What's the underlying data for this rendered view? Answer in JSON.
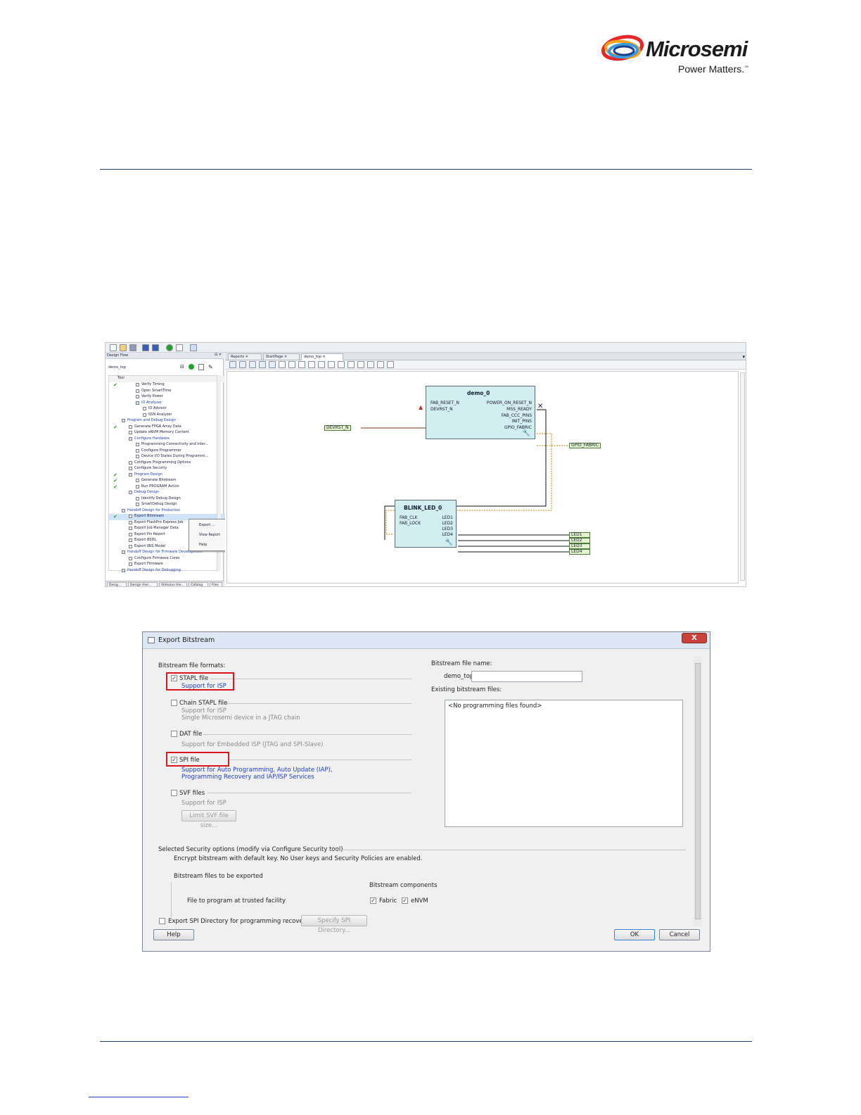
{
  "header": {
    "logo_text": "Microsemi",
    "tagline": "Power Matters.",
    "tm": "™"
  },
  "libero": {
    "design_flow": {
      "title": "Design Flow",
      "root": "demo_top",
      "column": "Tool",
      "items": [
        {
          "label": "Verify Timing",
          "indent": 46,
          "check": true,
          "blue": false
        },
        {
          "label": "Open SmartTime",
          "indent": 46,
          "check": false,
          "blue": false
        },
        {
          "label": "Verify Power",
          "indent": 46,
          "check": false,
          "blue": false
        },
        {
          "label": "IO Analyzer",
          "indent": 46,
          "check": false,
          "blue": true
        },
        {
          "label": "IO Advisor",
          "indent": 56,
          "check": false,
          "blue": false
        },
        {
          "label": "SSN Analyzer",
          "indent": 56,
          "check": false,
          "blue": false
        },
        {
          "label": "Program and Debug Design",
          "indent": 26,
          "check": false,
          "blue": true
        },
        {
          "label": "Generate FPGA Array Data",
          "indent": 36,
          "check": true,
          "blue": false
        },
        {
          "label": "Update eNVM Memory Content",
          "indent": 36,
          "check": false,
          "blue": false
        },
        {
          "label": "Configure Hardware",
          "indent": 36,
          "check": false,
          "blue": true
        },
        {
          "label": "Programming Connectivity and Inter...",
          "indent": 46,
          "check": false,
          "blue": false
        },
        {
          "label": "Configure Programmer",
          "indent": 46,
          "check": false,
          "blue": false
        },
        {
          "label": "Device I/O States During Programmi...",
          "indent": 46,
          "check": false,
          "blue": false
        },
        {
          "label": "Configure Programming Options",
          "indent": 36,
          "check": false,
          "blue": false
        },
        {
          "label": "Configure Security",
          "indent": 36,
          "check": false,
          "blue": false
        },
        {
          "label": "Program Design",
          "indent": 36,
          "check": true,
          "blue": true
        },
        {
          "label": "Generate Bitstream",
          "indent": 46,
          "check": true,
          "blue": false
        },
        {
          "label": "Run PROGRAM Action",
          "indent": 46,
          "check": true,
          "blue": false
        },
        {
          "label": "Debug Design",
          "indent": 36,
          "check": false,
          "blue": true
        },
        {
          "label": "Identify Debug Design",
          "indent": 46,
          "check": false,
          "blue": false
        },
        {
          "label": "SmartDebug Design",
          "indent": 46,
          "check": false,
          "blue": false
        },
        {
          "label": "Handoff Design for Production",
          "indent": 26,
          "check": false,
          "blue": true
        },
        {
          "label": "Export Bitstream",
          "indent": 36,
          "check": true,
          "blue": false,
          "selected": true
        },
        {
          "label": "Export FlashPro Express Job",
          "indent": 36,
          "check": false,
          "blue": false
        },
        {
          "label": "Export Job Manager Data",
          "indent": 36,
          "check": false,
          "blue": false
        },
        {
          "label": "Export Pin Report",
          "indent": 36,
          "check": false,
          "blue": false
        },
        {
          "label": "Export BSDL",
          "indent": 36,
          "check": false,
          "blue": false
        },
        {
          "label": "Export IBIS Model",
          "indent": 36,
          "check": false,
          "blue": false
        },
        {
          "label": "Handoff Design for Firmware Development",
          "indent": 26,
          "check": false,
          "blue": true
        },
        {
          "label": "Configure Firmware Cores",
          "indent": 36,
          "check": false,
          "blue": false
        },
        {
          "label": "Export Firmware",
          "indent": 36,
          "check": false,
          "blue": false
        },
        {
          "label": "Handoff Design for Debugging",
          "indent": 26,
          "check": false,
          "blue": true
        }
      ],
      "bottom_tabs": [
        "Desig...",
        "Design Hier...",
        "Stimulus Hie...",
        "Catalog",
        "Files"
      ]
    },
    "context_menu": [
      "Export ...",
      "View Report",
      "Help"
    ],
    "tabs": [
      "Reports",
      "StartPage",
      "demo_top"
    ],
    "canvas": {
      "demo_comp": {
        "name": "demo_0",
        "inputs": [
          "FAB_RESET_N",
          "DEVRST_N"
        ],
        "outputs": [
          "POWER_ON_RESET_N",
          "MSS_READY",
          "FAB_CCC_PINS",
          "INIT_PINS",
          "GPIO_FABRIC"
        ]
      },
      "blink_comp": {
        "name": "BLINK_LED_0",
        "inputs": [
          "FAB_CLK",
          "FAB_LOCK"
        ],
        "outputs": [
          "LED1",
          "LED2",
          "LED3",
          "LED4"
        ]
      },
      "in_port": "DEVRST_N",
      "gpio_port": "GPIO_FABRIC",
      "led_ports": [
        "LED1",
        "LED2",
        "LED3",
        "LED4"
      ]
    }
  },
  "dialog": {
    "title": "Export Bitstream",
    "close": "X",
    "formats_label": "Bitstream file formats:",
    "stapl": {
      "label": "STAPL file",
      "desc": "Support for ISP",
      "checked": true
    },
    "chain": {
      "label": "Chain STAPL file",
      "desc1": "Support for ISP",
      "desc2": "Single Microsemi device in a JTAG chain",
      "checked": false
    },
    "dat": {
      "label": "DAT file",
      "desc": "Support for Embedded ISP (JTAG and SPI-Slave)",
      "checked": false
    },
    "spi": {
      "label": "SPI file",
      "desc1": "Support for Auto Programming, Auto Update (IAP),",
      "desc2": "Programming Recovery and IAP/ISP Services",
      "checked": true
    },
    "svf": {
      "label": "SVF files",
      "desc": "Support for ISP",
      "checked": false,
      "button": "Limit SVF file size..."
    },
    "name_label": "Bitstream file name:",
    "name_prefix": "demo_top",
    "name_value": "",
    "existing_label": "Existing bitstream files:",
    "existing_empty": "<No programming files found>",
    "security_label": "Selected Security options (modify via Configure Security tool)",
    "security_text": "Encrypt bitstream with default key. No User keys and Security Policies are enabled.",
    "files_exported": "Bitstream files to be exported",
    "components_label": "Bitstream components",
    "trusted": "File to program at trusted facility",
    "fabric": "Fabric",
    "envm": "eNVM",
    "spi_dir_label": "Export SPI Directory for programming recovery",
    "spi_dir_button": "Specify SPI Directory...",
    "help": "Help",
    "ok": "OK",
    "cancel": "Cancel"
  }
}
